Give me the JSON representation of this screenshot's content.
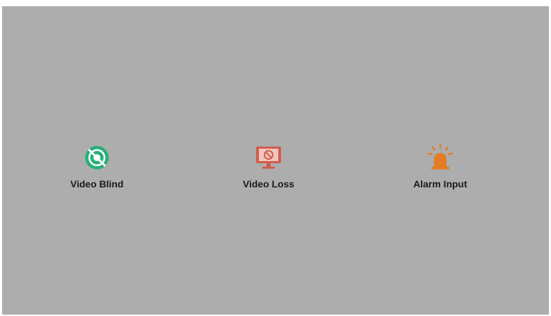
{
  "items": [
    {
      "label": "Video Blind",
      "icon": "video-blind-icon",
      "color": "#27b07a"
    },
    {
      "label": "Video Loss",
      "icon": "video-loss-icon",
      "color": "#d45a4b"
    },
    {
      "label": "Alarm Input",
      "icon": "alarm-light-icon",
      "color": "#e37d24"
    }
  ],
  "colors": {
    "background": "#adadad",
    "label": "#1a1a1a"
  }
}
